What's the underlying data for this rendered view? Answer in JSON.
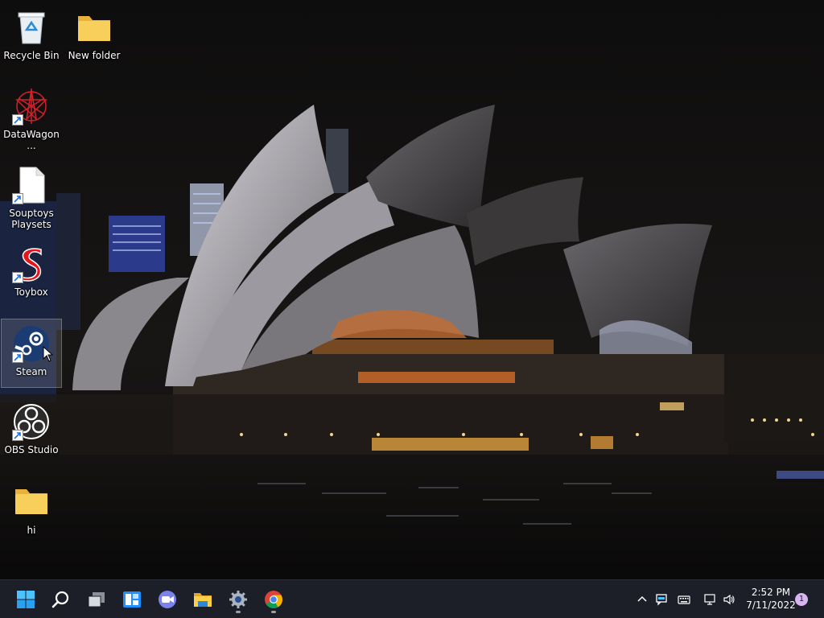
{
  "desktop": {
    "icons": [
      {
        "label": "Recycle Bin"
      },
      {
        "label": "New folder"
      },
      {
        "label": "DataWagon..."
      },
      {
        "label": "Souptoys Playsets"
      },
      {
        "label": "Toybox"
      },
      {
        "label": "Steam"
      },
      {
        "label": "OBS Studio"
      },
      {
        "label": "hi"
      }
    ]
  },
  "taskbar": {
    "items": [
      {
        "icon": "windows-start-icon"
      },
      {
        "icon": "search-icon"
      },
      {
        "icon": "task-view-icon"
      },
      {
        "icon": "widgets-icon"
      },
      {
        "icon": "teams-chat-icon"
      },
      {
        "icon": "file-explorer-icon"
      },
      {
        "icon": "settings-icon"
      },
      {
        "icon": "chrome-icon"
      }
    ],
    "tray": {
      "icons": [
        "chevron-up-icon",
        "message-icon",
        "keyboard-icon",
        "network-icon",
        "volume-icon"
      ],
      "time": "2:52 PM",
      "date": "7/11/2022",
      "notification_count": "1"
    }
  },
  "colors": {
    "taskbar_bg": "#1c1f27",
    "folder": "#f5c94a",
    "accent_start": "#4cc2ff"
  }
}
